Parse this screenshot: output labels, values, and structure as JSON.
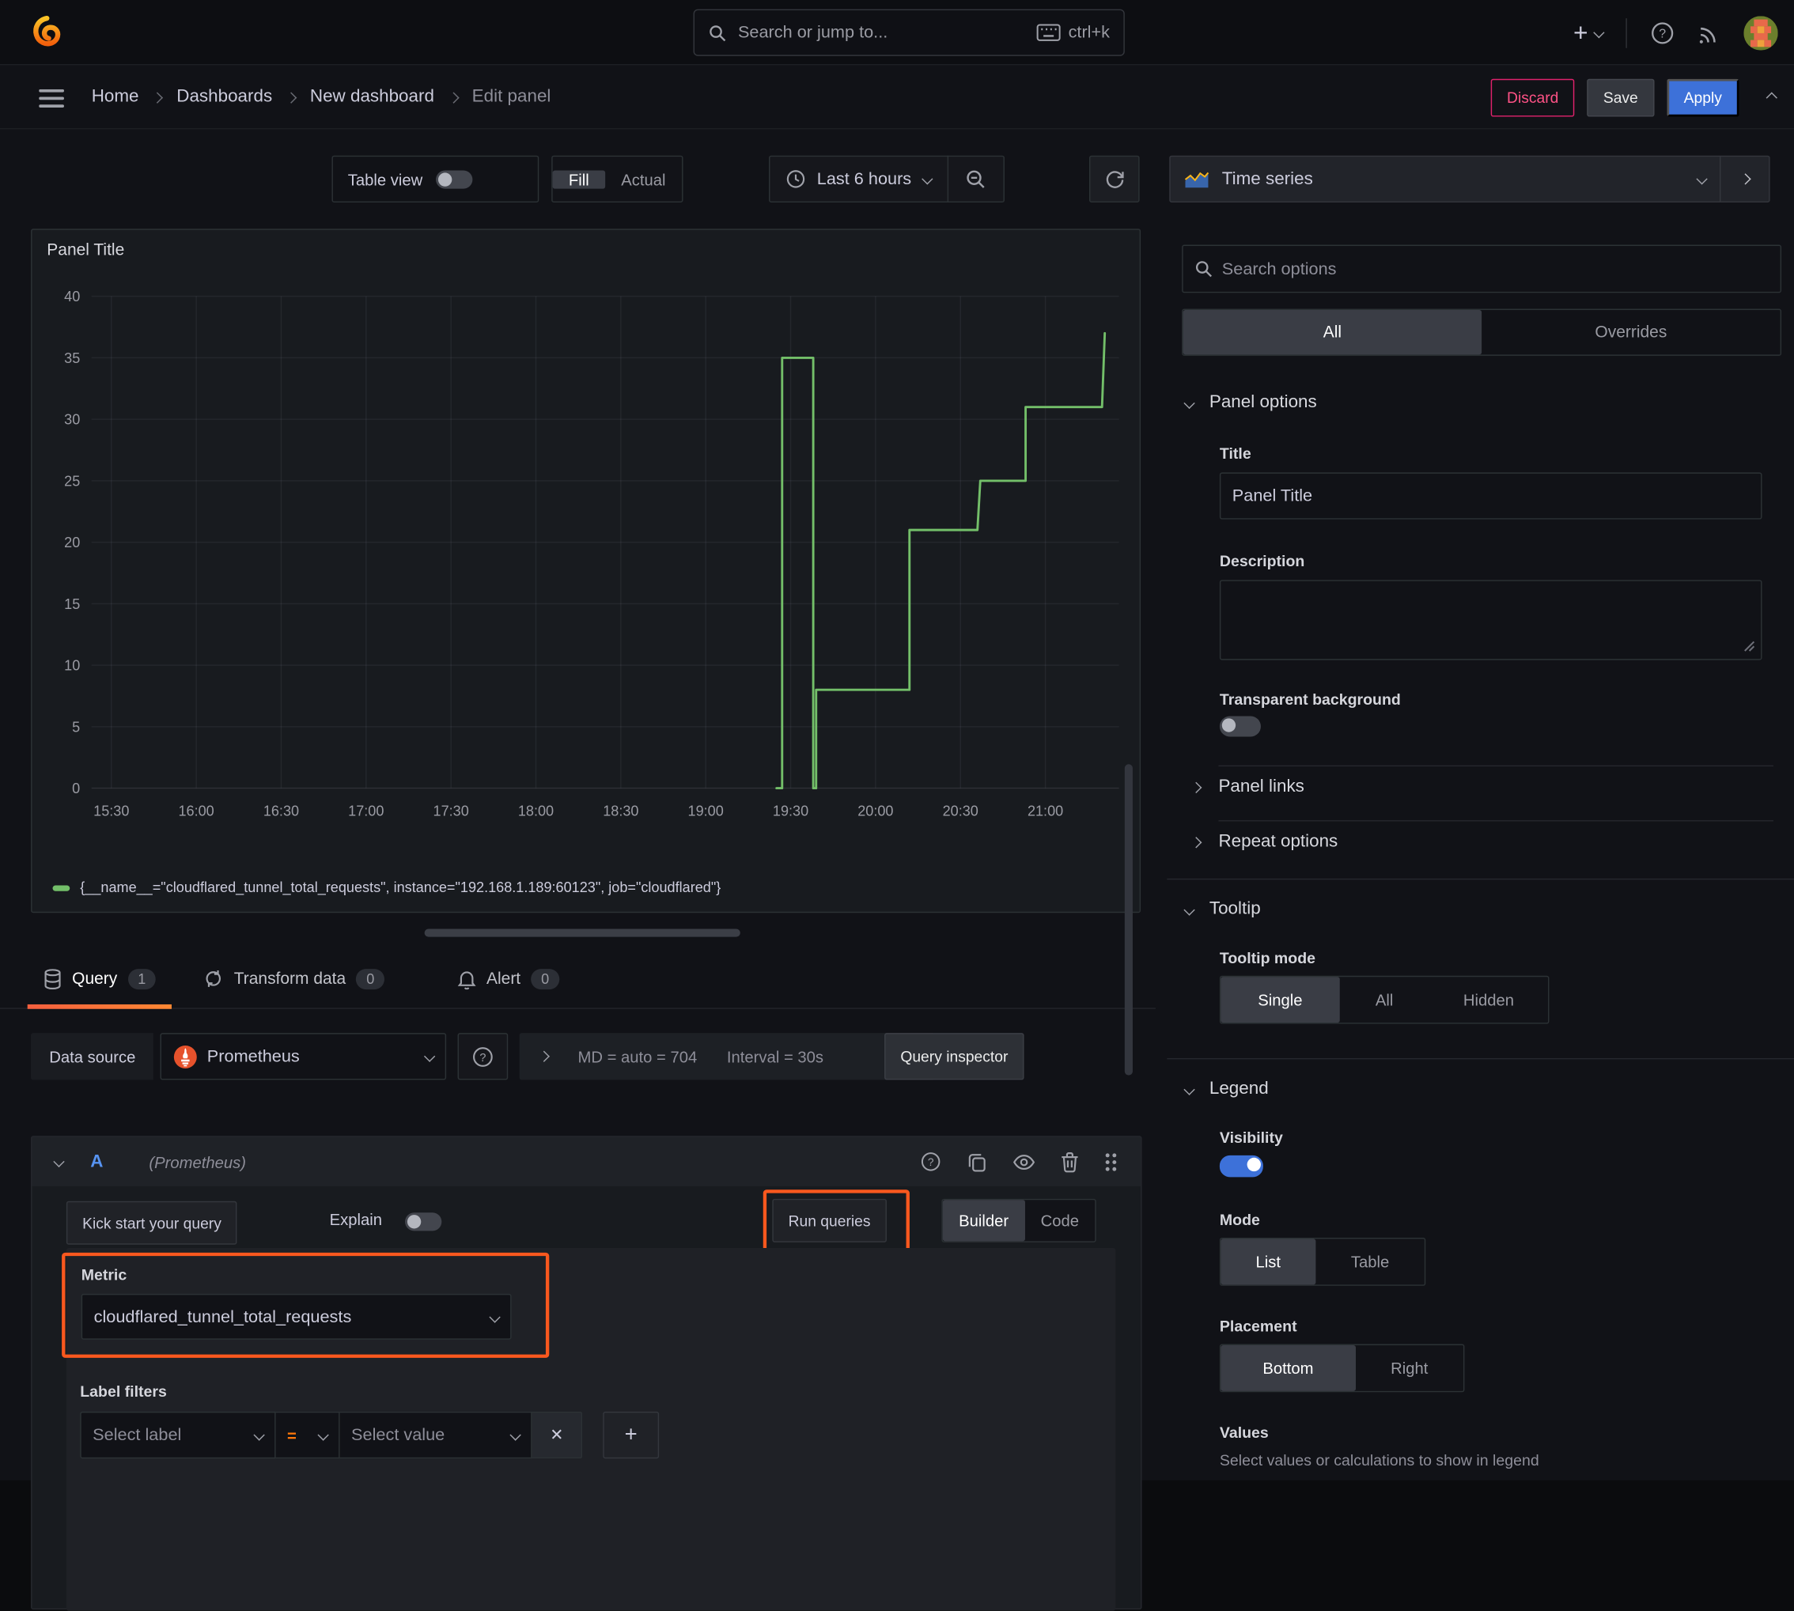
{
  "topnav": {
    "search_placeholder": "Search or jump to...",
    "shortcut": "ctrl+k"
  },
  "breadcrumb": {
    "items": [
      {
        "label": "Home"
      },
      {
        "label": "Dashboards"
      },
      {
        "label": "New dashboard"
      },
      {
        "label": "Edit panel"
      }
    ]
  },
  "actions": {
    "discard": "Discard",
    "save": "Save",
    "apply": "Apply"
  },
  "toolbar": {
    "table_view": "Table view",
    "fill": "Fill",
    "actual": "Actual",
    "time_range": "Last 6 hours"
  },
  "viz_picker": {
    "label": "Time series"
  },
  "panel": {
    "title": "Panel Title"
  },
  "chart_data": {
    "type": "line",
    "title": "Panel Title",
    "xlabel": "",
    "ylabel": "",
    "ylim": [
      0,
      40
    ],
    "grid": true,
    "legend_position": "bottom",
    "x_domain_minutes": [
      923,
      1286
    ],
    "x_ticks": [
      {
        "m": 930,
        "label": "15:30"
      },
      {
        "m": 960,
        "label": "16:00"
      },
      {
        "m": 990,
        "label": "16:30"
      },
      {
        "m": 1020,
        "label": "17:00"
      },
      {
        "m": 1050,
        "label": "17:30"
      },
      {
        "m": 1080,
        "label": "18:00"
      },
      {
        "m": 1110,
        "label": "18:30"
      },
      {
        "m": 1140,
        "label": "19:00"
      },
      {
        "m": 1170,
        "label": "19:30"
      },
      {
        "m": 1200,
        "label": "20:00"
      },
      {
        "m": 1230,
        "label": "20:30"
      },
      {
        "m": 1260,
        "label": "21:00"
      }
    ],
    "y_ticks": [
      0,
      5,
      10,
      15,
      20,
      25,
      30,
      35,
      40
    ],
    "series": [
      {
        "name": "{__name__=\"cloudflared_tunnel_total_requests\", instance=\"192.168.1.189:60123\", job=\"cloudflared\"}",
        "color": "#73bf69",
        "points_minutes_value": [
          [
            1165,
            0
          ],
          [
            1167,
            0
          ],
          [
            1167,
            35
          ],
          [
            1178,
            35
          ],
          [
            1178,
            0
          ],
          [
            1179,
            0
          ],
          [
            1179,
            8
          ],
          [
            1212,
            8
          ],
          [
            1212,
            21
          ],
          [
            1236,
            21
          ],
          [
            1237,
            25
          ],
          [
            1253,
            25
          ],
          [
            1253,
            31
          ],
          [
            1280,
            31
          ],
          [
            1281,
            37
          ]
        ]
      }
    ]
  },
  "tabs": {
    "query": "Query",
    "query_count": "1",
    "transform": "Transform data",
    "transform_count": "0",
    "alert": "Alert",
    "alert_count": "0"
  },
  "datasource_row": {
    "label": "Data source",
    "name": "Prometheus",
    "stat_md": "MD = auto = 704",
    "stat_interval": "Interval = 30s",
    "inspector": "Query inspector"
  },
  "query_editor": {
    "ref_id": "A",
    "ds_hint": "(Prometheus)",
    "kick_start": "Kick start your query",
    "explain": "Explain",
    "run_queries": "Run queries",
    "builder": "Builder",
    "code": "Code",
    "metric_label": "Metric",
    "metric_value": "cloudflared_tunnel_total_requests",
    "label_filters": "Label filters",
    "select_label": "Select label",
    "operator": "=",
    "select_value": "Select value"
  },
  "options_pane": {
    "search_placeholder": "Search options",
    "tab_all": "All",
    "tab_overrides": "Overrides",
    "panel_options": "Panel options",
    "title_label": "Title",
    "title_value": "Panel Title",
    "description_label": "Description",
    "transparent_bg": "Transparent background",
    "panel_links": "Panel links",
    "repeat_options": "Repeat options",
    "tooltip": "Tooltip",
    "tooltip_mode": "Tooltip mode",
    "tt_single": "Single",
    "tt_all": "All",
    "tt_hidden": "Hidden",
    "legend": "Legend",
    "visibility": "Visibility",
    "mode": "Mode",
    "mode_list": "List",
    "mode_table": "Table",
    "placement": "Placement",
    "pl_bottom": "Bottom",
    "pl_right": "Right",
    "values": "Values",
    "values_help": "Select values or calculations to show in legend"
  },
  "glyphs": {
    "question": "?",
    "plus": "+",
    "close": "✕",
    "chevron_right": "›"
  },
  "colors": {
    "accent_blue": "#3d71d9",
    "danger_pink": "#ff5286",
    "highlight_orange": "#f9581e",
    "series_green": "#73bf69",
    "prometheus_orange": "#e6522c"
  }
}
